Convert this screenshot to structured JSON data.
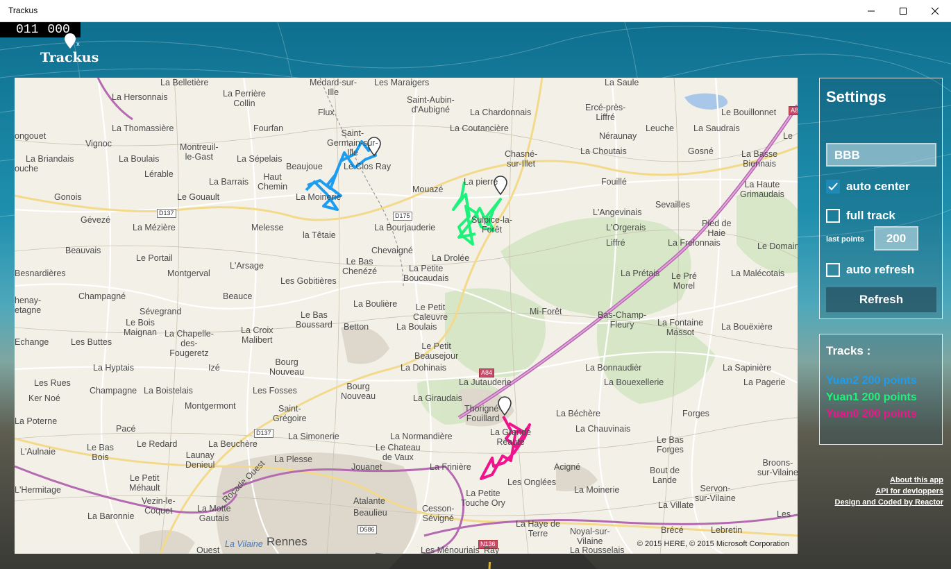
{
  "window": {
    "title": "Trackus"
  },
  "counter": {
    "left": "011",
    "right": "000"
  },
  "logo": {
    "text": "Trackus"
  },
  "settings": {
    "title": "Settings",
    "name_value": "BBB",
    "auto_center": {
      "label": "auto center",
      "checked": true
    },
    "full_track": {
      "label": "full track",
      "checked": false
    },
    "last_points": {
      "label": "last points",
      "value": "200"
    },
    "auto_refresh": {
      "label": "auto refresh",
      "checked": false
    },
    "refresh_label": "Refresh"
  },
  "tracks": {
    "title": "Tracks :",
    "items": [
      {
        "label": "Yuan2 200 points",
        "color": "#1e9df0"
      },
      {
        "label": "Yuan1 200 points",
        "color": "#1ff27a"
      },
      {
        "label": "Yuan0 200 points",
        "color": "#f0148c"
      }
    ]
  },
  "links": {
    "about": "About this app",
    "api": "API for devloppers",
    "credits": "Design and Coded by Reactor"
  },
  "map": {
    "copyright": "© 2015 HERE, © 2015 Microsoft Corporation",
    "roads": [
      "D137",
      "D175",
      "A84",
      "D137",
      "D586",
      "N136",
      "A84"
    ],
    "roads_visible": {
      "d137a": "D137",
      "d175": "D175",
      "a84": "A84",
      "d137b": "D137",
      "d586": "D586",
      "n136": "N136",
      "a84b": "A84"
    },
    "places": {
      "p1": "La Belletière",
      "p2": "Medard-sur-\nIlle",
      "p3": "Les Maraigers",
      "p4": "La Saule",
      "p5": "La Hersonnais",
      "p6": "La Perrière\nCollin",
      "p7": "Saint-Aubin-\nd'Aubigné",
      "p8": "Ercé-près-\nLiffré",
      "p9": "Le Bouillonnet",
      "p10": "La Chardonnais",
      "p11": "Flux",
      "p12": "La Thomassière",
      "p13": "Fourfan",
      "p14": "La Coutancière",
      "p15": "Néraunay",
      "p16": "Leuche",
      "p17": "La Saudrais",
      "p18": "Le",
      "p19": "ongouet",
      "p20": "Saint-\nGermain-sur-\nIlle",
      "p21": "Vignoc",
      "p22": "Montreuil-\nle-Gast",
      "p23": "La Choutais",
      "p24": "Gosné",
      "p25": "La Basse\nBiennais",
      "p26": "La Briandais",
      "p27": "La Boulais",
      "p28": "La Sépelais",
      "p29": "Le Clos Ray",
      "p30": "Chasné-\nsur-Illet",
      "p31": "ouche",
      "p32": "Lérable",
      "p33": "Beaujoue",
      "p34": "La pierre",
      "p35": "Fouillé",
      "p36": "La Haute\nGrimaudais",
      "p37": "La Barrais",
      "p38": "Haut\nChemin",
      "p39": "Mouazé",
      "p40": "Gonois",
      "p41": "Le Gouault",
      "p42": "La Moinerie",
      "p43": "Sevailles",
      "p44": "L'Angevinais",
      "p45": "Gévezé",
      "p46": "La Mézière",
      "p47": "Melesse",
      "p48": "La Bourjauderie",
      "p49": "Sulpice-la-\nForêt",
      "p50": "L'Orgerais",
      "p51": "Pied de\nHaie",
      "p52": "La Frelonnais",
      "p53": "Liffré",
      "p54": "Le Domaine",
      "p55": "la Têtaie",
      "p56": "Chevaigné",
      "p57": "Beauvais",
      "p58": "Le Portail",
      "p59": "L'Arsage",
      "p60": "Le Bas\nChenézé",
      "p61": "La Drolée",
      "p62": "La Petite\nBoucaudais",
      "p63": "La Prétais",
      "p64": "La Malécotais",
      "p65": "Le Pré\nMorel",
      "p66": "Besnardières",
      "p67": "Montgerval",
      "p68": "Les Gobitières",
      "p69": "Champagné",
      "p70": "Beauce",
      "p71": "La Boulière",
      "p72": "Le Petit\nCaleuvre",
      "p73": "Mi-Forêt",
      "p74": "Bas-Champ-\nFleury",
      "p75": "La Fontaine\nMassot",
      "p76": "La Bouëxière",
      "p77": "henay-\netagne",
      "p78": "Sévegrand",
      "p79": "Le Bois\nMaignan",
      "p80": "La Croix\nMalibert",
      "p81": "Le Bas\nBoussard",
      "p82": "Betton",
      "p83": "La Boulais",
      "p84": "La Chapelle-\ndes-\nFougeretz",
      "p85": "Les Buttes",
      "p86": "Echange",
      "p87": "Le Petit\nBeausejour",
      "p88": "La Dohinais",
      "p89": "La Hyptais",
      "p90": "Izé",
      "p91": "Bourg\nNouveau",
      "p92": "La Bonnaudièr",
      "p93": "La Sapinière",
      "p94": "Les Rues",
      "p95": "Champagne",
      "p96": "La Boistelais",
      "p97": "Les Fosses",
      "p98": "Bourg\nNouveau",
      "p99": "La Jutauderie",
      "p100": "La Bouexellerie",
      "p101": "La Pagerie",
      "p102": "Ker Noé",
      "p103": "Montgermont",
      "p104": "Saint-\nGrégoire",
      "p105": "La Giraudais",
      "p106": "Thorigné-\nFouillard",
      "p107": "La Béchère",
      "p108": "Forges",
      "p109": "La Poterne",
      "p110": "Pacé",
      "p111": "La Simonerie",
      "p112": "La Normandière",
      "p113": "La Chauvinais",
      "p114": "Le Bas\nBois",
      "p115": "Le Redard",
      "p116": "La Beuchère",
      "p117": "Launay\nDenieul",
      "p118": "Le Chateau\nde Vaux",
      "p119": "La Grande\nRéaute",
      "p120": "Le Bas\nForges",
      "p121": "L'Aulnaie",
      "p122": "La Plesse",
      "p123": "Jouanet",
      "p124": "La Frinière",
      "p125": "Acigné",
      "p126": "Broons-\nsur-Vilaine",
      "p127": "Le Petit\nMéhault",
      "p128": "Les Onglées",
      "p129": "Bout de\nLande",
      "p130": "Servon-\nsur-Vilaine",
      "p131": "L'Hermitage",
      "p132": "Vezin-le-\nCoquet",
      "p133": "Atalante",
      "p134": "La Petite\nTouche Ory",
      "p135": "La Moinerie",
      "p136": "Cesson-\nSévigné",
      "p137": "La Villate",
      "p138": "La Baronnie",
      "p139": "La Motte\nGautais",
      "p140": "Beaulieu",
      "p141": "La Haye de\nTerre",
      "p142": "Noyal-sur-\nVilaine",
      "p143": "Brécé",
      "p144": "Lebretin",
      "p145": "Les",
      "p146": "Rennes",
      "p147": "Rocade Ouest",
      "p148": "La Vilaine",
      "p149": "Les Ménouriais",
      "p150": "Ray",
      "p151": "La Rousselais",
      "p152": "Ouest"
    }
  }
}
